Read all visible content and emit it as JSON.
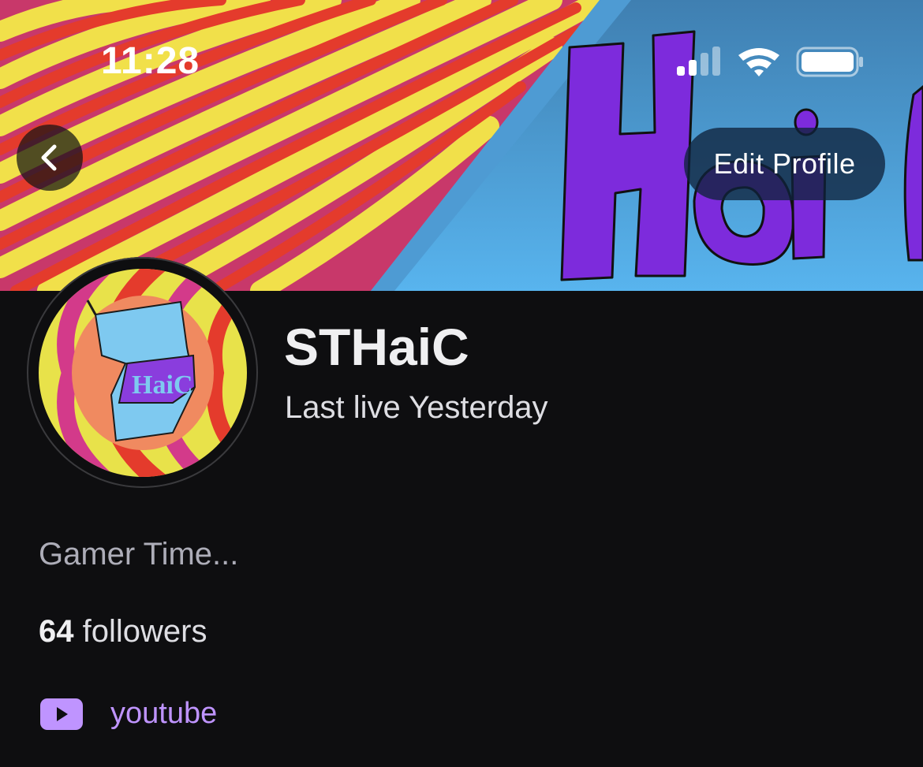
{
  "status_bar": {
    "time": "11:28",
    "icons": [
      "cellular-signal-icon",
      "wifi-icon",
      "battery-icon"
    ]
  },
  "header": {
    "back_icon": "chevron-left-icon",
    "edit_profile_label": "Edit Profile"
  },
  "profile": {
    "display_name": "STHaiC",
    "last_live": "Last live Yesterday",
    "bio": "Gamer Time...",
    "followers_count": "64",
    "followers_label": " followers",
    "social_link": {
      "icon": "youtube-icon",
      "label": "youtube",
      "color": "#bf94ff"
    }
  },
  "colors": {
    "background": "#0e0e10",
    "accent": "#bf94ff"
  }
}
